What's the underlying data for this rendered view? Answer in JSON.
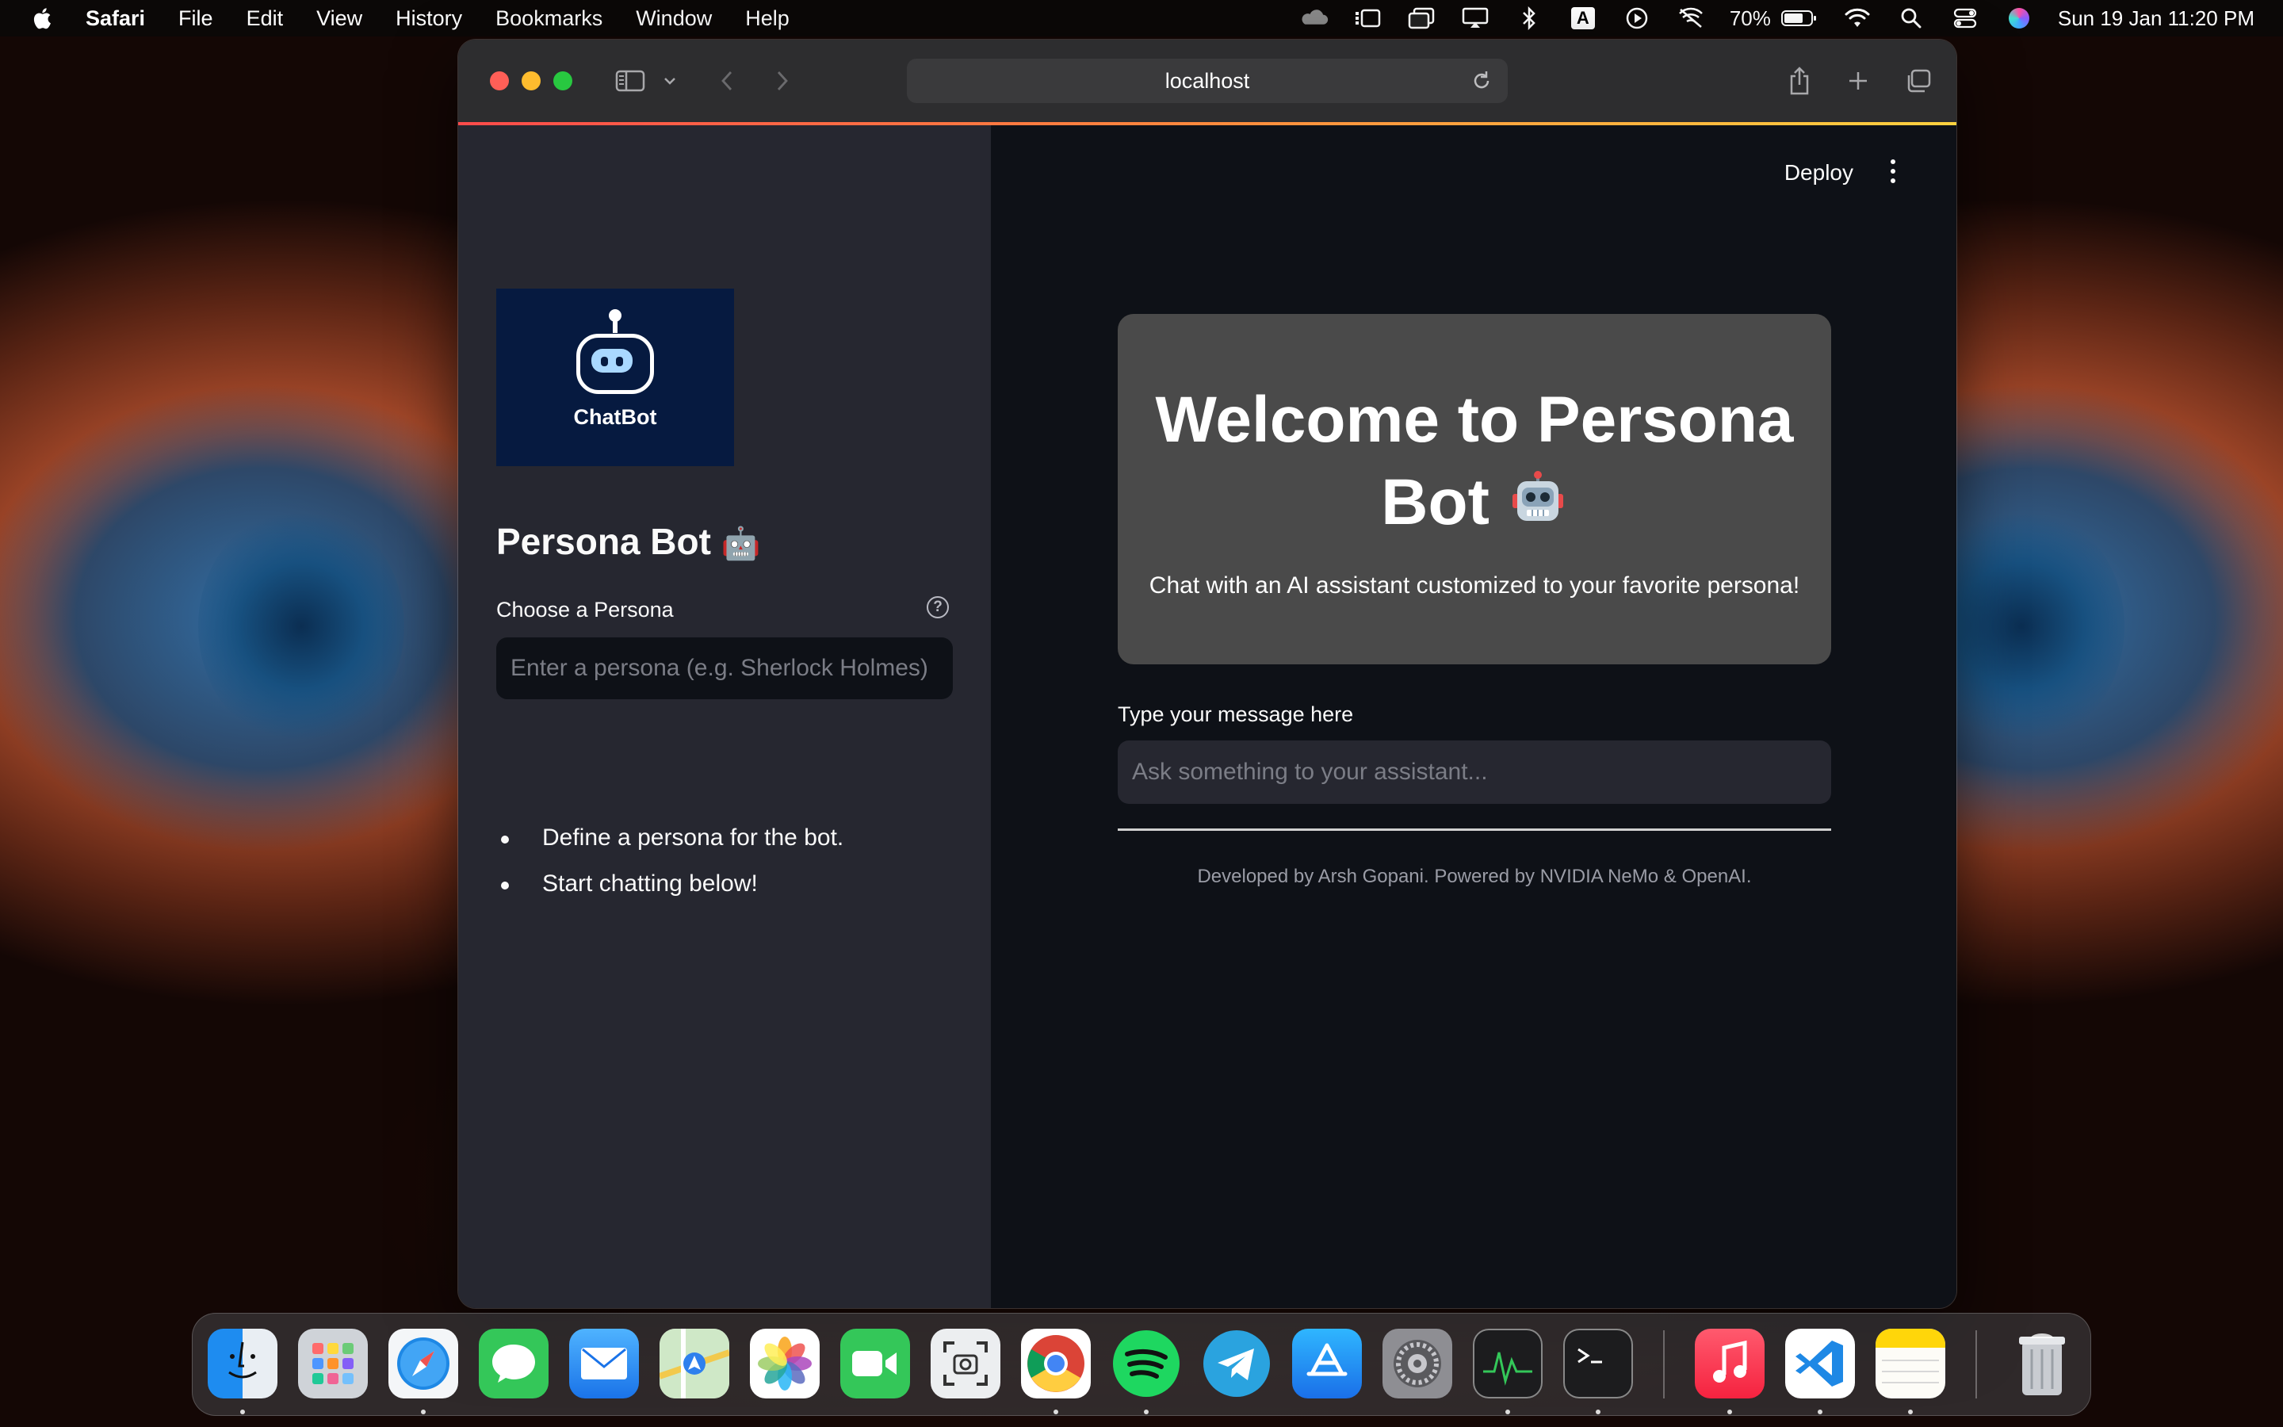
{
  "menubar": {
    "app_name": "Safari",
    "menus": [
      "File",
      "Edit",
      "View",
      "History",
      "Bookmarks",
      "Window",
      "Help"
    ],
    "battery": "70%",
    "datetime": "Sun 19 Jan  11:20 PM",
    "input_source": "A"
  },
  "browser": {
    "url": "localhost"
  },
  "sidebar": {
    "logo_text": "ChatBot",
    "title": "Persona Bot",
    "title_emoji": "🤖",
    "persona_label": "Choose a Persona",
    "help_glyph": "?",
    "persona_placeholder": "Enter a persona (e.g. Sherlock Holmes)",
    "instructions": [
      "Define a persona for the bot.",
      "Start chatting below!"
    ]
  },
  "main": {
    "deploy_label": "Deploy",
    "welcome_title": "Welcome to Persona Bot",
    "welcome_subtitle": "Chat with an AI assistant customized to your favorite persona!",
    "message_label": "Type your message here",
    "message_placeholder": "Ask something to your assistant...",
    "footer": "Developed by Arsh Gopani. Powered by NVIDIA NeMo & OpenAI."
  },
  "dock": {
    "apps": [
      "finder-icon",
      "launchpad-icon",
      "safari-icon",
      "messages-icon",
      "mail-icon",
      "maps-icon",
      "photos-icon",
      "facetime-icon",
      "screenshot-icon",
      "chrome-icon",
      "spotify-icon",
      "telegram-icon",
      "app-store-icon",
      "system-settings-icon",
      "activity-monitor-icon",
      "terminal-icon",
      "music-icon",
      "vscode-icon",
      "notes-icon",
      "trash-icon"
    ]
  },
  "colors": {
    "streamlit_bg": "#0e1117",
    "sidebar_bg": "#262730",
    "welcome_card": "#4a4a4a",
    "accent": "#ff4b4b"
  }
}
